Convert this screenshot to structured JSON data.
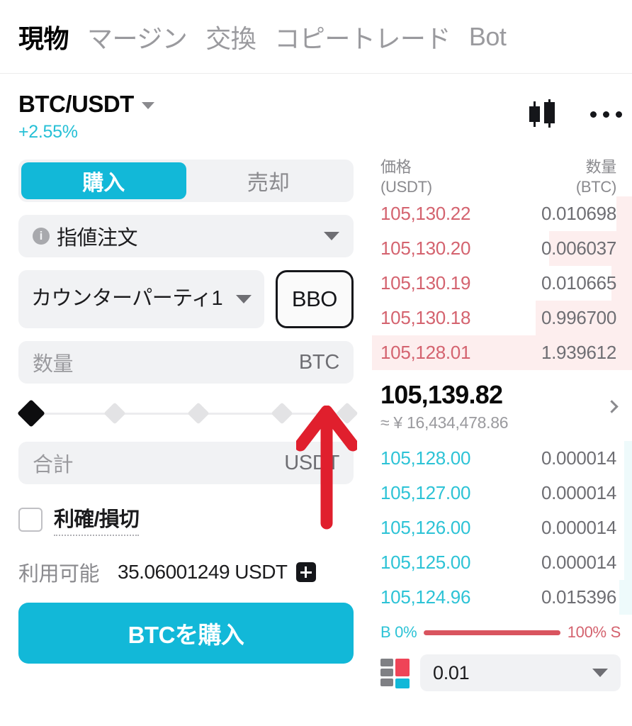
{
  "nav": {
    "tabs": [
      {
        "label": "現物",
        "active": true
      },
      {
        "label": "マージン",
        "active": false
      },
      {
        "label": "交換",
        "active": false
      },
      {
        "label": "コピートレード",
        "active": false
      },
      {
        "label": "Bot",
        "active": false
      }
    ]
  },
  "header": {
    "pair": "BTC/USDT",
    "change_pct": "+2.55%",
    "chart_icon": "candlestick-chart-icon",
    "more_icon": "more-options-icon"
  },
  "order_form": {
    "side_buy": "購入",
    "side_sell": "売却",
    "active_side": "購入",
    "order_type": "指値注文",
    "order_type_info_icon": "info-icon",
    "counterparty": "カウンターパーティ1",
    "bbo_label": "BBO",
    "quantity_placeholder": "数量",
    "quantity_unit": "BTC",
    "total_placeholder": "合計",
    "total_unit": "USDT",
    "slider_positions": [
      "0",
      "25",
      "50",
      "75",
      "100"
    ],
    "slider_value_index": 0,
    "tpsl_label": "利確/損切",
    "tpsl_checked": false,
    "available_label": "利用可能",
    "available_value": "35.06001249 USDT",
    "add_funds_icon": "plus-icon",
    "submit_label": "BTCを購入"
  },
  "orderbook": {
    "col_price": "価格",
    "col_price_unit": "(USDT)",
    "col_qty": "数量",
    "col_qty_unit": "(BTC)",
    "asks": [
      {
        "price": "105,130.22",
        "qty": "0.010698",
        "depth": 6
      },
      {
        "price": "105,130.20",
        "qty": "0.006037",
        "depth": 32
      },
      {
        "price": "105,130.19",
        "qty": "0.010665",
        "depth": 8
      },
      {
        "price": "105,130.18",
        "qty": "0.996700",
        "depth": 37
      },
      {
        "price": "105,128.01",
        "qty": "1.939612",
        "depth": 100
      }
    ],
    "bids": [
      {
        "price": "105,128.00",
        "qty": "0.000014",
        "depth": 3
      },
      {
        "price": "105,127.00",
        "qty": "0.000014",
        "depth": 3
      },
      {
        "price": "105,126.00",
        "qty": "0.000014",
        "depth": 3
      },
      {
        "price": "105,125.00",
        "qty": "0.000014",
        "depth": 3
      },
      {
        "price": "105,124.96",
        "qty": "0.015396",
        "depth": 5
      }
    ],
    "last_price": "105,139.82",
    "last_price_fiat": "≈ ¥ 16,434,478.86",
    "expand_icon": "chevron-right-icon",
    "ratio_buy": "B 0%",
    "ratio_sell": "100% S",
    "layout_icon": "orderbook-layout-icon",
    "tick_size": "0.01"
  },
  "annotation": {
    "arrow_icon": "red-up-arrow-annotation",
    "color": "#e01f2d",
    "points_at": "BBO"
  },
  "colors": {
    "accent_cyan": "#12b8d8",
    "ask_red": "#d4636f",
    "bid_cyan": "#2dc3d6",
    "annotation_red": "#e01f2d"
  }
}
